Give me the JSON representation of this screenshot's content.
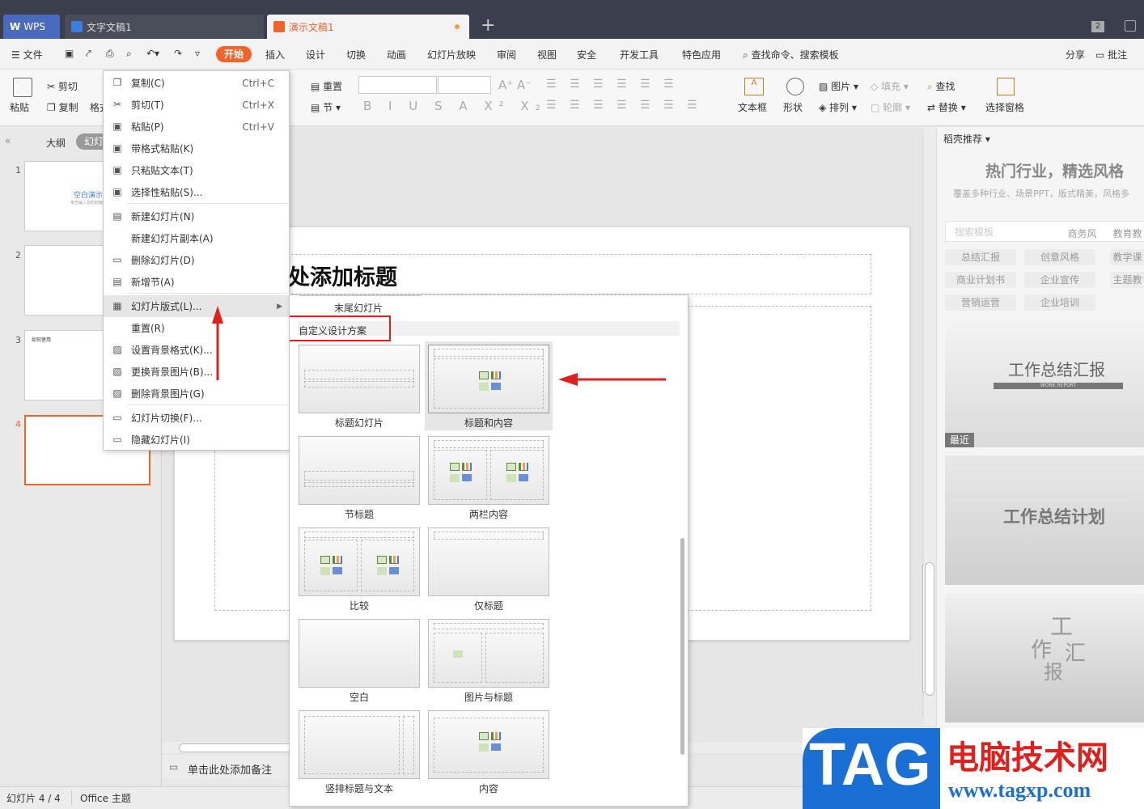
{
  "titlebar": {
    "wps_tab": "WPS",
    "doc_tab": "文字文稿1",
    "ppt_tab": "演示文稿1",
    "add_tab": "+",
    "badge": "2"
  },
  "menubar": {
    "file": "文件",
    "start": "开始",
    "items": [
      "插入",
      "设计",
      "切换",
      "动画",
      "幻灯片放映",
      "审阅",
      "视图",
      "安全",
      "开发工具",
      "特色应用"
    ],
    "search": "查找命令、搜索模板",
    "share": "分享",
    "comment": "批注"
  },
  "ribbon": {
    "paste": "粘贴",
    "cut": "剪切",
    "copy": "复制",
    "format": "格式",
    "reset": "重置",
    "section": "节",
    "textbox": "文本框",
    "shape": "形状",
    "picture": "图片",
    "fill": "填充",
    "arrange": "排列",
    "outline": "轮廓",
    "find": "查找",
    "replace": "替换",
    "select_pane": "选择窗格"
  },
  "leftpanel": {
    "outline_tab": "大纲",
    "slides_tab": "幻灯片",
    "slide_numbers": [
      "1",
      "2",
      "3",
      "4"
    ],
    "thumb1_title": "空白演示",
    "thumb1_sub": "单击输入您的封面副标题",
    "thumb3_text": "如何使用"
  },
  "slide": {
    "title": "处添加标题",
    "notes": "单击此处添加备注"
  },
  "context_menu": [
    {
      "icon": "copy-icon",
      "label": "复制(C)",
      "shortcut": "Ctrl+C"
    },
    {
      "icon": "cut-icon",
      "label": "剪切(T)",
      "shortcut": "Ctrl+X"
    },
    {
      "icon": "paste-icon",
      "label": "粘贴(P)",
      "shortcut": "Ctrl+V"
    },
    {
      "icon": "paste-format-icon",
      "label": "带格式粘贴(K)",
      "shortcut": ""
    },
    {
      "icon": "paste-text-icon",
      "label": "只粘贴文本(T)",
      "shortcut": ""
    },
    {
      "icon": "paste-special-icon",
      "label": "选择性粘贴(S)...",
      "shortcut": ""
    },
    {
      "icon": "new-slide-icon",
      "label": "新建幻灯片(N)",
      "shortcut": ""
    },
    {
      "icon": "",
      "label": "新建幻灯片副本(A)",
      "shortcut": ""
    },
    {
      "icon": "delete-slide-icon",
      "label": "删除幻灯片(D)",
      "shortcut": ""
    },
    {
      "icon": "new-section-icon",
      "label": "新增节(A)",
      "shortcut": ""
    },
    {
      "icon": "layout-icon",
      "label": "幻灯片版式(L)...",
      "shortcut": ""
    },
    {
      "icon": "",
      "label": "重置(R)",
      "shortcut": ""
    },
    {
      "icon": "background-format-icon",
      "label": "设置背景格式(K)...",
      "shortcut": ""
    },
    {
      "icon": "change-background-icon",
      "label": "更换背景图片(B)...",
      "shortcut": ""
    },
    {
      "icon": "delete-background-icon",
      "label": "删除背景图片(G)",
      "shortcut": ""
    },
    {
      "icon": "transition-icon",
      "label": "幻灯片切换(F)...",
      "shortcut": ""
    },
    {
      "icon": "hide-slide-icon",
      "label": "隐藏幻灯片(I)",
      "shortcut": ""
    }
  ],
  "layout_submenu": {
    "top_item": "末尾幻灯片",
    "custom_scheme": "自定义设计方案",
    "layouts": [
      "标题幻灯片",
      "标题和内容",
      "节标题",
      "两栏内容",
      "比较",
      "仅标题",
      "空白",
      "图片与标题",
      "竖排标题与文本",
      "内容"
    ]
  },
  "rightpanel": {
    "header": "稻壳推荐",
    "banner_title": "热门行业，精选风格",
    "banner_sub": "覆盖多种行业、场景PPT，版式精美，风格多",
    "search_placeholder": "搜索模板",
    "tags": [
      "商务风",
      "教育教",
      "总结汇报",
      "创意风格",
      "教学课",
      "商业计划书",
      "企业宣传",
      "主题教",
      "营销运营",
      "企业培训"
    ],
    "recent_label": "最近",
    "template1_title": "工作总结汇报",
    "template1_sub": "WORK  REPORT",
    "template2_title": "工作总结计划",
    "template3_chars": [
      "工",
      "作",
      "汇",
      "报"
    ]
  },
  "statusbar": {
    "slide_count": "幻灯片 4 / 4",
    "theme": "Office 主题"
  },
  "watermark": {
    "tag": "TAG",
    "title": "电脑技术网",
    "url": "www.tagxp.com"
  },
  "colors": {
    "accent": "#f0642a",
    "highlight_box": "#e0201c",
    "arrow": "#e0201c",
    "titlebar": "#3b3e4c",
    "watermark_blue": "#1a6fd4"
  }
}
